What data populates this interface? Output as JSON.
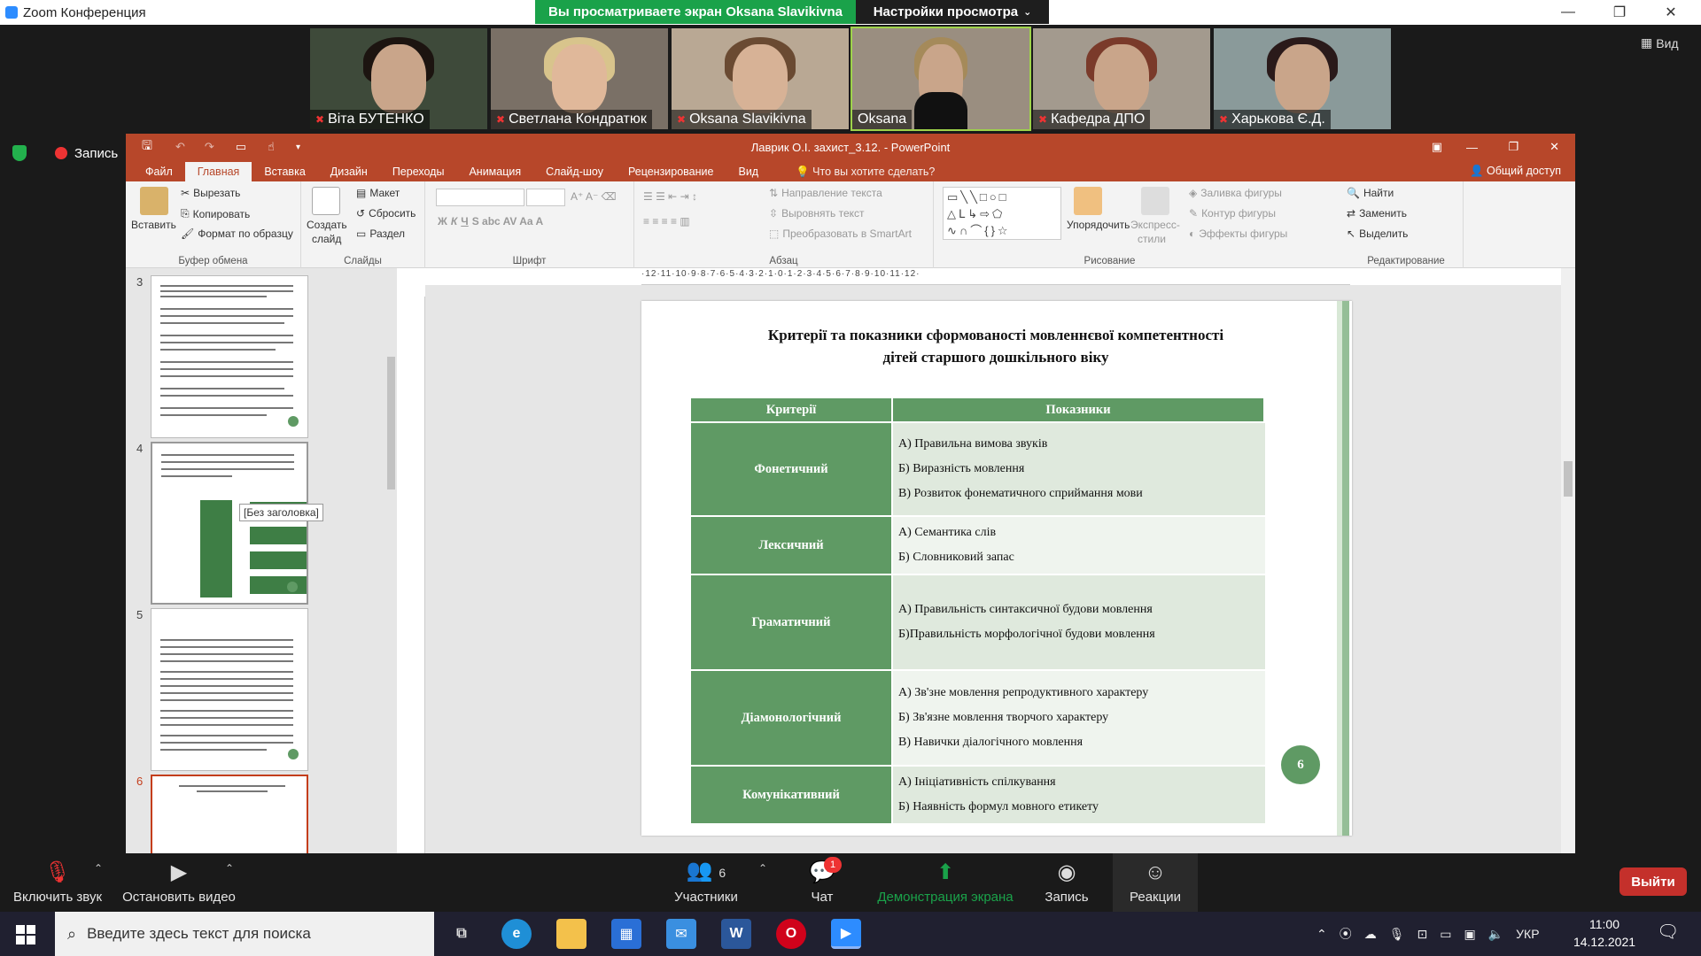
{
  "zoom": {
    "app_title": "Zoom Конференция",
    "share_banner": "Вы просматриваете экран Oksana Slavikivna",
    "view_settings": "Настройки просмотра",
    "view_label": "Вид",
    "recording_label": "Запись",
    "participants_tiles": [
      {
        "name": "Віта БУТЕНКО",
        "muted": true
      },
      {
        "name": "Светлана Кондратюк",
        "muted": true
      },
      {
        "name": "Oksana Slavikivna",
        "muted": true
      },
      {
        "name": "Oksana",
        "muted": false
      },
      {
        "name": "Кафедра ДПО",
        "muted": true
      },
      {
        "name": "Харькова Є.Д.",
        "muted": true
      }
    ],
    "toolbar": {
      "unmute": "Включить звук",
      "stop_video": "Остановить видео",
      "participants": "Участники",
      "participants_count": "6",
      "chat": "Чат",
      "chat_badge": "1",
      "share_screen": "Демонстрация экрана",
      "record": "Запись",
      "reactions": "Реакции",
      "leave": "Выйти"
    }
  },
  "powerpoint": {
    "doc_title": "Лаврик О.І. захист_3.12. - PowerPoint",
    "tabs": [
      "Файл",
      "Главная",
      "Вставка",
      "Дизайн",
      "Переходы",
      "Анимация",
      "Слайд-шоу",
      "Рецензирование",
      "Вид"
    ],
    "active_tab": "Главная",
    "tell_me": "Что вы хотите сделать?",
    "share": "Общий доступ",
    "ribbon": {
      "clipboard": {
        "paste": "Вставить",
        "cut": "Вырезать",
        "copy": "Копировать",
        "format_painter": "Формат по образцу",
        "label": "Буфер обмена"
      },
      "slides": {
        "new_slide_1": "Создать",
        "new_slide_2": "слайд",
        "layout": "Макет",
        "reset": "Сбросить",
        "section": "Раздел",
        "label": "Слайды"
      },
      "font": {
        "label": "Шрифт"
      },
      "paragraph": {
        "text_direction": "Направление текста",
        "align_text": "Выровнять текст",
        "smartart": "Преобразовать в SmartArt",
        "label": "Абзац"
      },
      "drawing": {
        "arrange": "Упорядочить",
        "quick_styles_1": "Экспресс-",
        "quick_styles_2": "стили",
        "fill": "Заливка фигуры",
        "outline": "Контур фигуры",
        "effects": "Эффекты фигуры",
        "label": "Рисование"
      },
      "editing": {
        "find": "Найти",
        "replace": "Заменить",
        "select": "Выделить",
        "label": "Редактирование"
      }
    },
    "thumbnails": [
      {
        "number": "3"
      },
      {
        "number": "4"
      },
      {
        "number": "5"
      },
      {
        "number": "6"
      }
    ],
    "thumb_tooltip": "[Без заголовка]",
    "ruler_text": "·12·11·10·9·8·7·6·5·4·3·2·1·0·1·2·3·4·5·6·7·8·9·10·11·12·",
    "slide": {
      "title_line1": "Критерії та показники сформованості мовленнєвої компетентності",
      "title_line2": "дітей старшого дошкільного віку",
      "col_criteria": "Критерії",
      "col_indicators": "Показники",
      "rows": [
        {
          "criterion": "Фонетичний",
          "indicators": [
            "А) Правильна вимова звуків",
            "Б) Виразність мовлення",
            "В) Розвиток фонематичного сприймання мови"
          ]
        },
        {
          "criterion": "Лексичний",
          "indicators": [
            "А) Семантика слів",
            "Б) Словниковий запас"
          ]
        },
        {
          "criterion": "Граматичний",
          "indicators": [
            "А) Правильність синтаксичної будови мовлення",
            "Б)Правильність морфологічної будови мовлення"
          ]
        },
        {
          "criterion": "Діамонологічний",
          "indicators": [
            "А) Зв'зне мовлення репродуктивного характеру",
            "Б) Зв'язне мовлення творчого характеру",
            "В) Навички діалогічного мовлення"
          ]
        },
        {
          "criterion": "Комунікативний",
          "indicators": [
            "А) Ініціативність спілкування",
            "Б) Наявність формул мовного етикету"
          ]
        }
      ],
      "page_number": "6"
    }
  },
  "taskbar": {
    "search_placeholder": "Введите здесь текст для поиска",
    "language": "УКР",
    "time": "11:00",
    "date": "14.12.2021"
  }
}
